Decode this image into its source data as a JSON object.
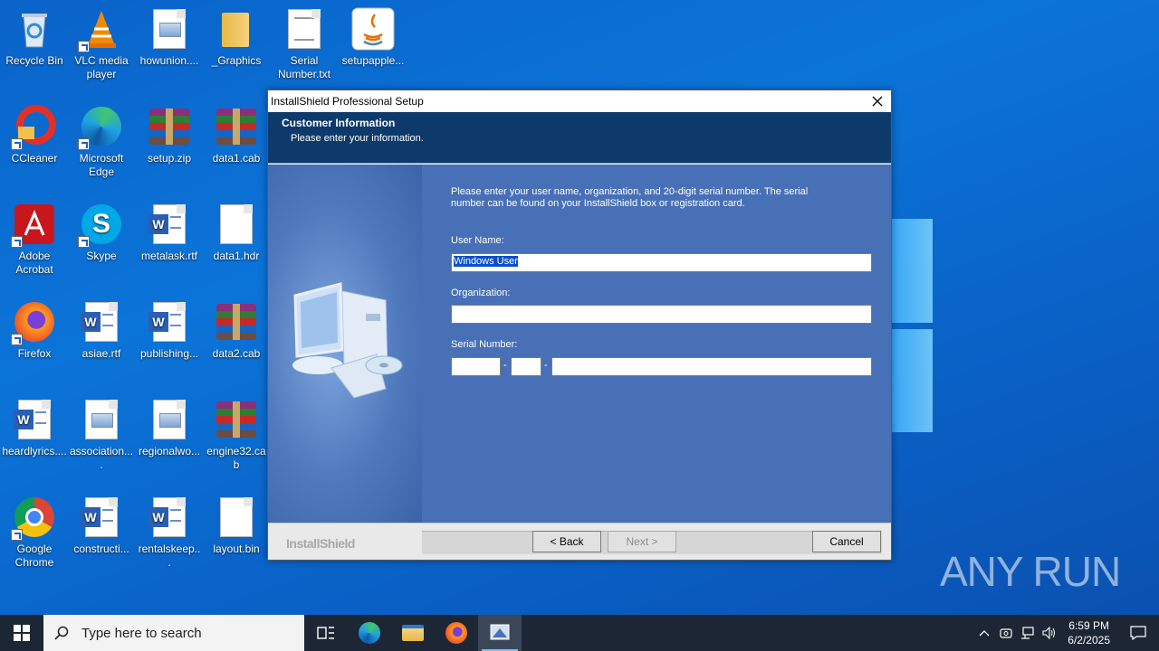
{
  "desktop": {
    "icons": [
      {
        "label": "Recycle Bin"
      },
      {
        "label": "VLC media player"
      },
      {
        "label": "howunion...."
      },
      {
        "label": "_Graphics"
      },
      {
        "label": "Serial Number.txt"
      },
      {
        "label": "setupapple..."
      },
      {
        "label": "CCleaner"
      },
      {
        "label": "Microsoft Edge"
      },
      {
        "label": "setup.zip"
      },
      {
        "label": "data1.cab"
      },
      {
        "label": "Adobe Acrobat"
      },
      {
        "label": "Skype"
      },
      {
        "label": "metalask.rtf"
      },
      {
        "label": "data1.hdr"
      },
      {
        "label": "Firefox"
      },
      {
        "label": "asiae.rtf"
      },
      {
        "label": "publishing..."
      },
      {
        "label": "data2.cab"
      },
      {
        "label": "heardlyrics...."
      },
      {
        "label": "association...."
      },
      {
        "label": "regionalwo..."
      },
      {
        "label": "engine32.cab"
      },
      {
        "label": "Google Chrome"
      },
      {
        "label": "constructi..."
      },
      {
        "label": "rentalskeep..."
      },
      {
        "label": "layout.bin"
      }
    ],
    "watermark": "ANY RUN"
  },
  "dialog": {
    "title": "InstallShield Professional Setup",
    "header_title": "Customer Information",
    "header_subtitle": "Please enter your information.",
    "description": "Please enter your user name, organization, and 20-digit serial number. The serial number can be found on your InstallShield box or registration card.",
    "user_name_label": "User Name:",
    "user_name_value": "Windows User",
    "organization_label": "Organization:",
    "organization_value": "",
    "serial_label": "Serial Number:",
    "serial_sep": "-",
    "brand": "InstallShield",
    "back_label": "< Back",
    "next_label": "Next >",
    "cancel_label": "Cancel"
  },
  "taskbar": {
    "search_placeholder": "Type here to search",
    "time": "6:59 PM",
    "date": "6/2/2025"
  },
  "colors": {
    "desktop": "#0b6fd6",
    "dialog_header": "#0d3a6b",
    "dialog_body": "#4870b6",
    "taskbar": "#1c2634"
  }
}
